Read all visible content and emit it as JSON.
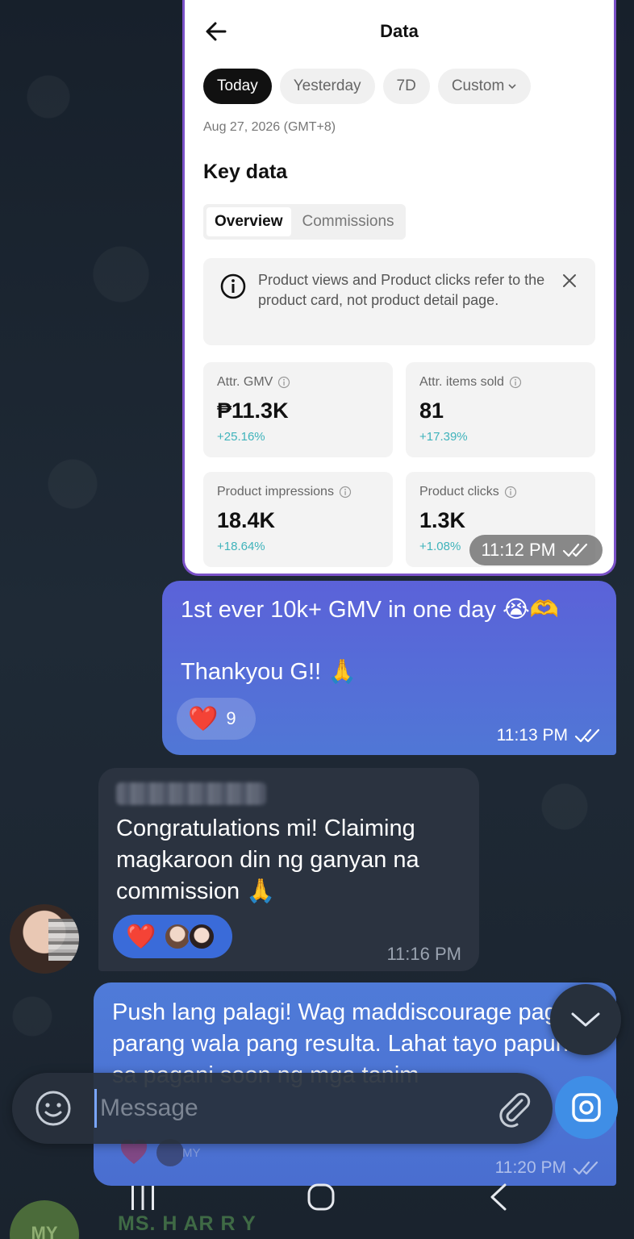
{
  "screenshot": {
    "title": "Data",
    "chips": [
      {
        "label": "Today",
        "active": true
      },
      {
        "label": "Yesterday",
        "active": false
      },
      {
        "label": "7D",
        "active": false
      },
      {
        "label": "Custom",
        "active": false
      }
    ],
    "date": "Aug 27, 2026 (GMT+8)",
    "key_data": "Key data",
    "tabs": [
      {
        "label": "Overview",
        "active": true
      },
      {
        "label": "Commissions",
        "active": false
      }
    ],
    "notice": "Product views and Product clicks refer to the product card, not product detail page.",
    "cards": [
      {
        "label": "Attr. GMV",
        "value": "₱11.3K",
        "change": "+25.16%"
      },
      {
        "label": "Attr. items sold",
        "value": "81",
        "change": "+17.39%"
      },
      {
        "label": "Product impressions",
        "value": "18.4K",
        "change": "+18.64%"
      },
      {
        "label": "Product clicks",
        "value": "1.3K",
        "change": "+1.08%"
      }
    ],
    "time": "11:12 PM"
  },
  "message1": {
    "line1": "1st ever 10k+ GMV in one day 😭🫶",
    "line2": "Thankyou G!! 🙏",
    "reaction_emoji": "❤️",
    "reaction_count": "9",
    "time": "11:13 PM"
  },
  "message2": {
    "text": "Congratulations mi! Claiming magkaroon din ng ganyan na commission 🙏",
    "reaction_emoji": "❤️",
    "time": "11:16 PM"
  },
  "message3": {
    "text": "Push lang palagi! Wag maddiscourage pag parang wala pang resulta. Lahat tayo papunta sa pagani soon ng mga tanim",
    "time": "11:20 PM",
    "reaction_initials": "MY"
  },
  "input": {
    "placeholder": "Message"
  },
  "peek": {
    "avatar_initials": "MY",
    "name": "MS. H AR R Y"
  },
  "colors": {
    "outgoing": "#5b62d9",
    "incoming": "#2b3340",
    "accent": "#3f8ee6",
    "change_teal": "#3fb3bb"
  }
}
